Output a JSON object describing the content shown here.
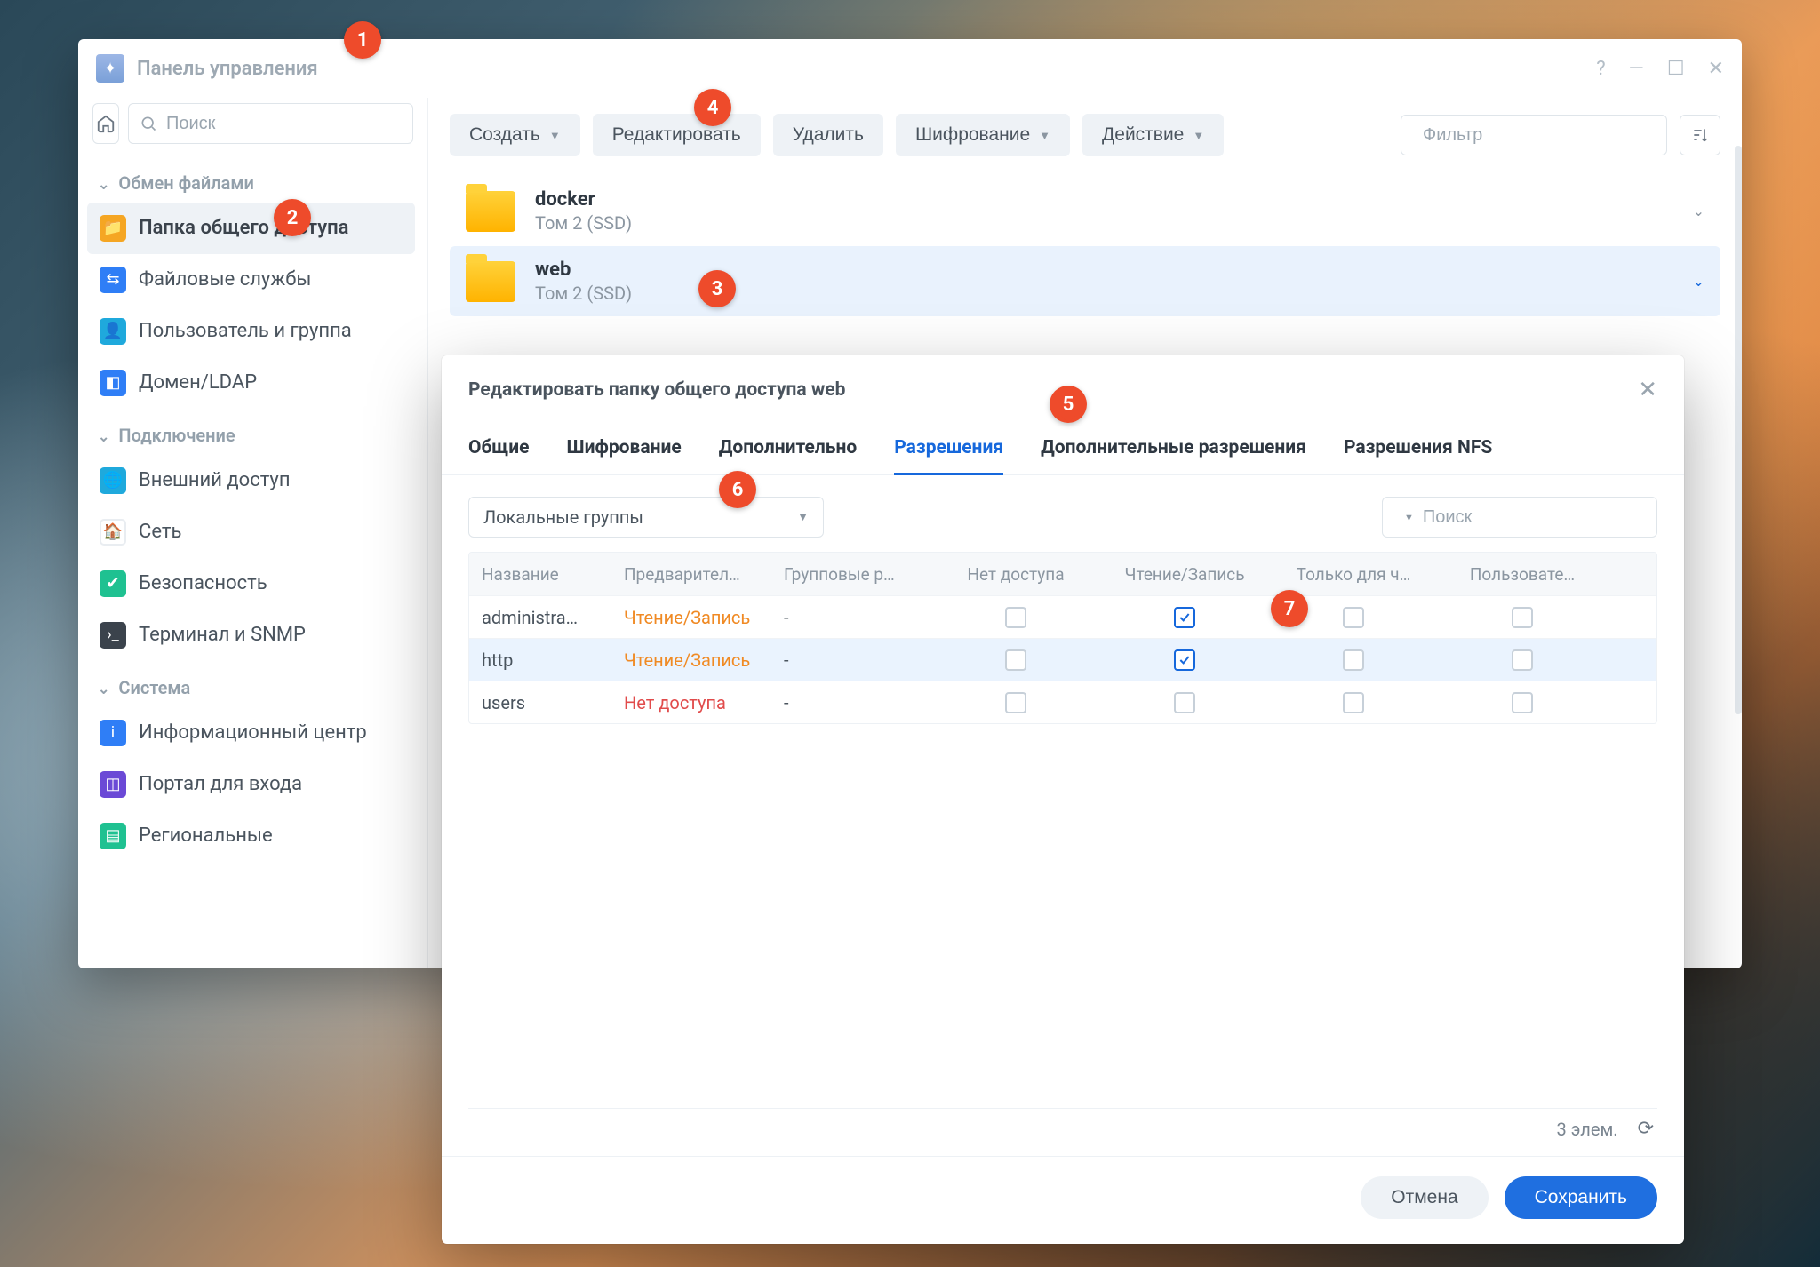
{
  "window": {
    "title": "Панель управления"
  },
  "sidebar": {
    "search_placeholder": "Поиск",
    "sections": {
      "filesharing": "Обмен файлами",
      "connection": "Подключение",
      "system": "Система"
    },
    "items": {
      "shared_folder": "Папка общего доступа",
      "file_services": "Файловые службы",
      "user_group": "Пользователь и группа",
      "domain_ldap": "Домен/LDAP",
      "external_access": "Внешний доступ",
      "network": "Сеть",
      "security": "Безопасность",
      "terminal_snmp": "Терминал и SNMP",
      "info_center": "Информационный центр",
      "portal": "Портал для входа",
      "regional": "Региональные"
    }
  },
  "toolbar": {
    "create": "Создать",
    "edit": "Редактировать",
    "delete": "Удалить",
    "encryption": "Шифрование",
    "action": "Действие",
    "filter_placeholder": "Фильтр"
  },
  "folders": [
    {
      "name": "docker",
      "sub": "Том 2 (SSD)",
      "selected": false
    },
    {
      "name": "web",
      "sub": "Том 2 (SSD)",
      "selected": true
    }
  ],
  "dialog": {
    "title": "Редактировать папку общего доступа web",
    "tabs": {
      "general": "Общие",
      "encryption": "Шифрование",
      "advanced": "Дополнительно",
      "permissions": "Разрешения",
      "adv_perm": "Дополнительные разрешения",
      "nfs_perm": "Разрешения NFS"
    },
    "active_tab": "permissions",
    "group_select": "Локальные группы",
    "search_placeholder": "Поиск",
    "columns": {
      "name": "Название",
      "preview": "Предварител…",
      "group_perm": "Групповые р…",
      "no_access": "Нет доступа",
      "rw": "Чтение/Запись",
      "ro": "Только для ч…",
      "custom": "Пользовате…"
    },
    "rows": [
      {
        "name": "administra…",
        "preview": "Чтение/Запись",
        "preview_kind": "rw",
        "group_perm": "-",
        "no_access": false,
        "rw": true,
        "ro": false,
        "custom": false,
        "selected": false
      },
      {
        "name": "http",
        "preview": "Чтение/Запись",
        "preview_kind": "rw",
        "group_perm": "-",
        "no_access": false,
        "rw": true,
        "ro": false,
        "custom": false,
        "selected": true
      },
      {
        "name": "users",
        "preview": "Нет доступа",
        "preview_kind": "na",
        "group_perm": "-",
        "no_access": false,
        "rw": false,
        "ro": false,
        "custom": false,
        "selected": false
      }
    ],
    "count_label": "3 элем.",
    "cancel": "Отмена",
    "save": "Сохранить"
  },
  "callouts": {
    "1": "1",
    "2": "2",
    "3": "3",
    "4": "4",
    "5": "5",
    "6": "6",
    "7": "7"
  }
}
